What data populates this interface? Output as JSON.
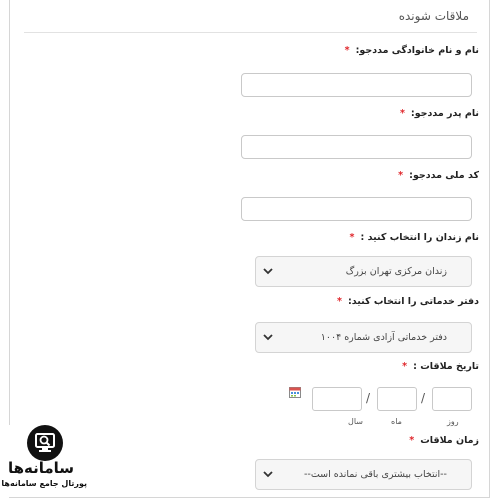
{
  "section": {
    "title": "ملاقات شونده"
  },
  "fields": {
    "full_name_label": "نام و نام خانوادگی مددجو:",
    "father_name_label": "نام پدر مددجو:",
    "national_code_label": "کد ملی مددجو:",
    "prison_label": "نام زندان را انتخاب کنید :",
    "office_label": "دفتر خدماتی را انتخاب کنید:",
    "date_label": "تاریخ ملاقات :",
    "time_label": "زمان ملاقات",
    "required_mark": "*"
  },
  "selects": {
    "prison_value": "زندان مرکزی تهران بزرگ",
    "office_value": "دفتر خدماتی آزادی شماره ۱۰۰۴",
    "time_value": "--انتخاب بیشتری باقی نمانده است--"
  },
  "date": {
    "day_label": "روز",
    "month_label": "ماه",
    "year_label": "سال",
    "separator": "/"
  },
  "logo": {
    "title": "سامانه‌ها",
    "subtitle": "پورتال جامع سامانه‌ها"
  },
  "colors": {
    "required": "#e0262b",
    "border": "#c9c9c9",
    "select_bg": "#f6f6f6"
  },
  "icons": [
    "calendar-icon",
    "chevron-down-icon",
    "search-monitor-icon"
  ]
}
